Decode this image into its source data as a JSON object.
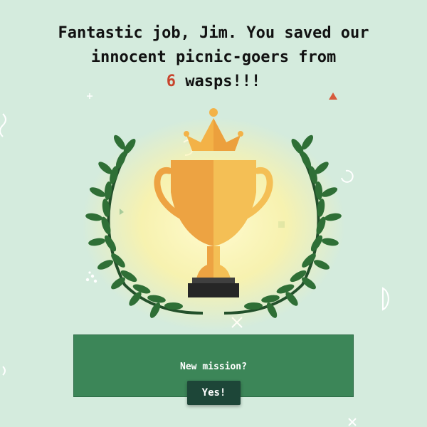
{
  "message": {
    "line1": "Fantastic job, Jim. You saved our",
    "line2": "innocent picnic-goers from",
    "count": "6",
    "line3_suffix": " wasps!!!"
  },
  "dialog": {
    "prompt": "New mission?",
    "confirm_label": "Yes!"
  },
  "graphics": {
    "trophy_icon": "trophy-icon",
    "crown_icon": "crown-icon",
    "laurel_icon": "laurel-wreath-icon"
  },
  "colors": {
    "background": "#d4ebdd",
    "highlight": "#c8442c",
    "panel": "#3c8658",
    "button": "#1d4638",
    "trophy_light": "#f4bf55",
    "trophy_dark": "#eda342",
    "laurel": "#2f6f36"
  }
}
